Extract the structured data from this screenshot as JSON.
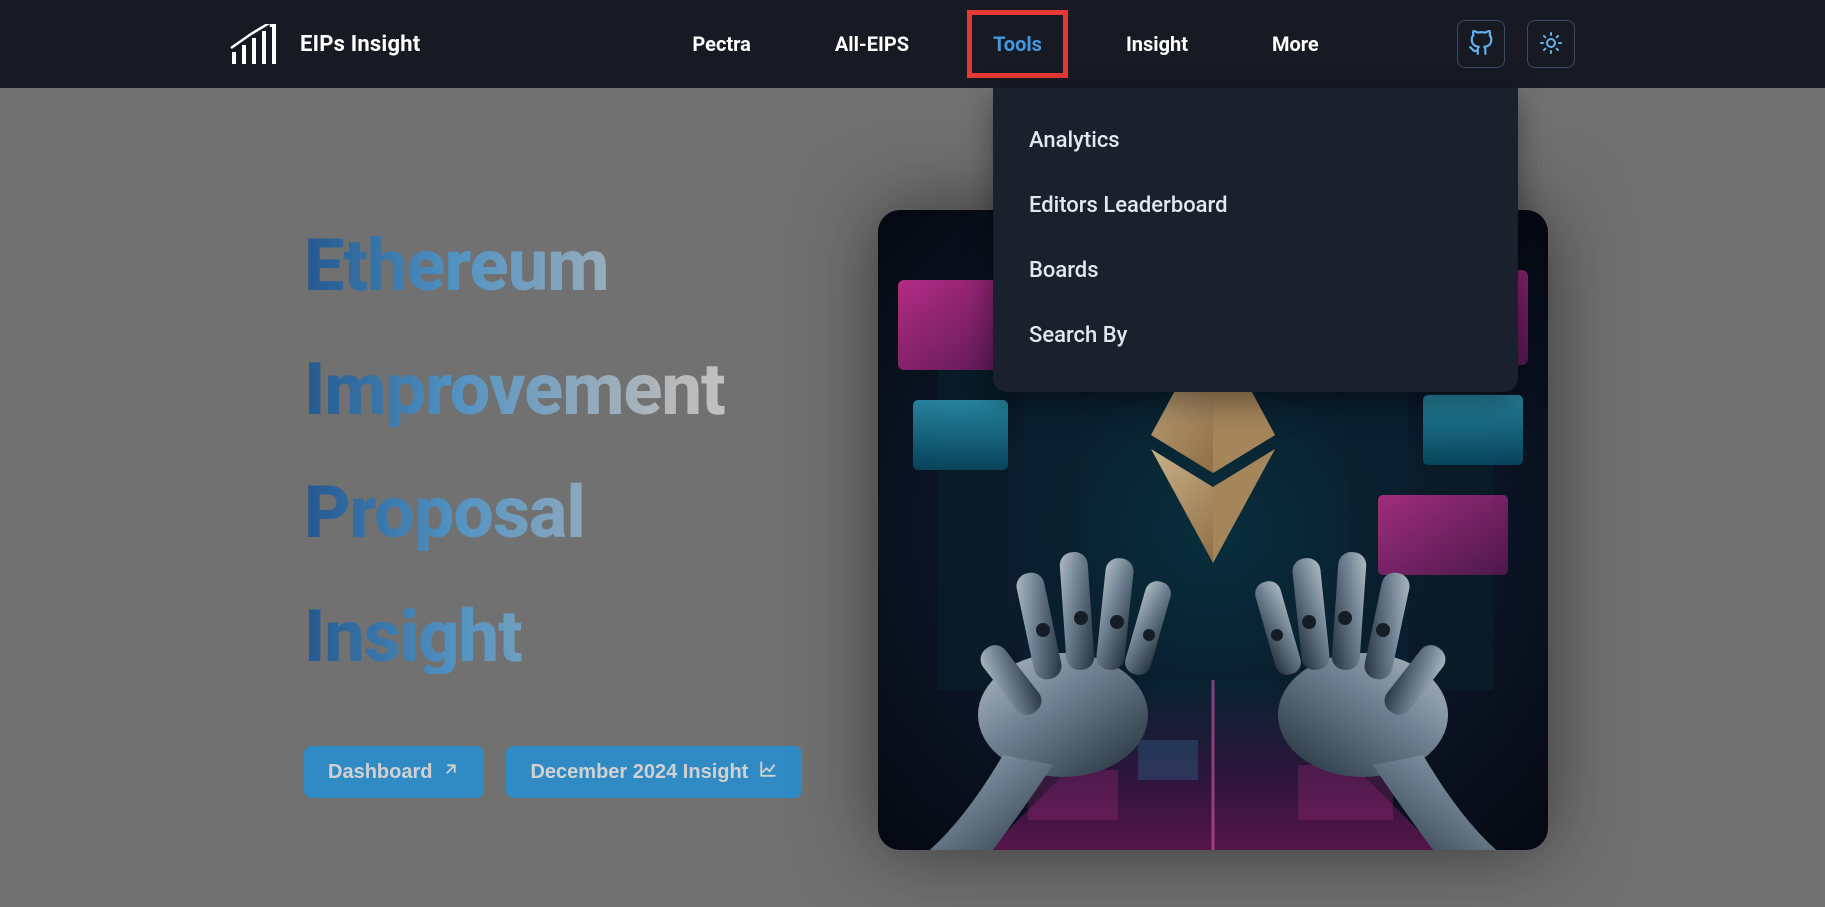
{
  "brand": {
    "name": "EIPs Insight"
  },
  "nav": {
    "items": [
      {
        "label": "Pectra"
      },
      {
        "label": "All-EIPS"
      },
      {
        "label": "Tools",
        "active": true
      },
      {
        "label": "Insight"
      },
      {
        "label": "More"
      }
    ]
  },
  "dropdown": {
    "items": [
      {
        "label": "Analytics"
      },
      {
        "label": "Editors Leaderboard"
      },
      {
        "label": "Boards"
      },
      {
        "label": "Search By"
      }
    ]
  },
  "hero": {
    "words": [
      "Ethereum",
      "Improvement",
      "Proposal",
      "Insight"
    ]
  },
  "buttons": {
    "dashboard": "Dashboard",
    "insight": "December 2024 Insight"
  },
  "colors": {
    "accent": "#4299e1",
    "navbar_bg": "#171923",
    "dropdown_bg": "#1a202c",
    "button_bg": "#3baaf0",
    "highlight": "#e53935"
  }
}
